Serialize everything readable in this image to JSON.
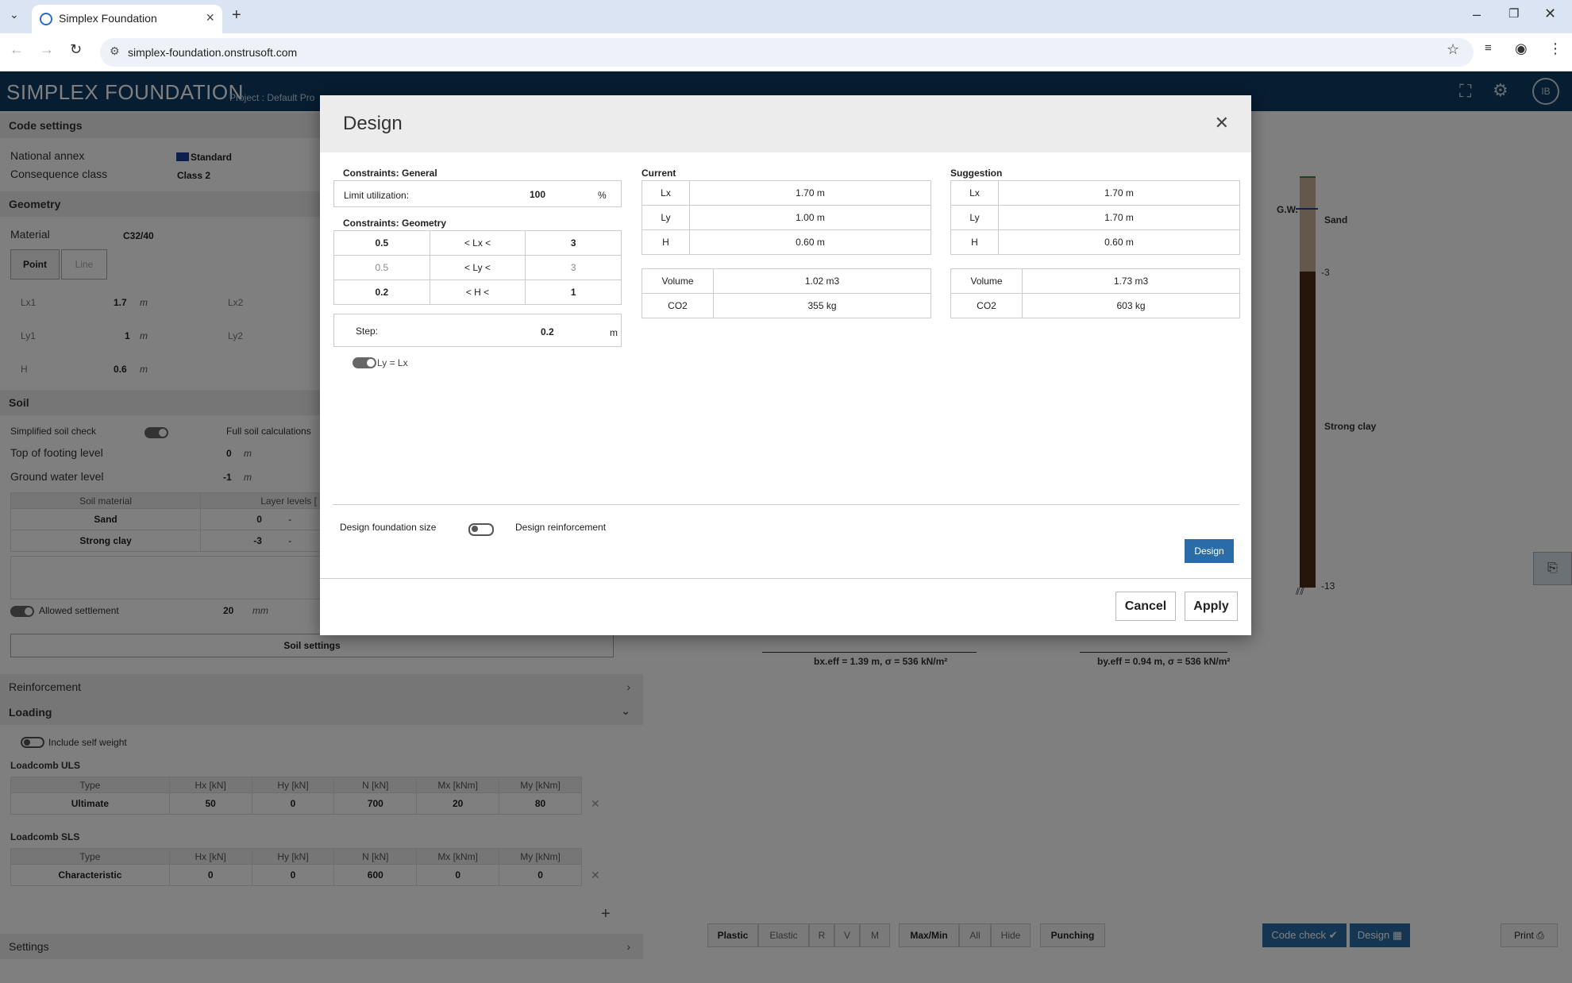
{
  "browser": {
    "tab_title": "Simplex Foundation",
    "url": "simplex-foundation.onstrusoft.com"
  },
  "app": {
    "brand_simplex": "SIMPLEX",
    "brand_foundation": "FOUNDATION",
    "project_label": "Project :",
    "project_name": "Default Pro",
    "avatar": "IB"
  },
  "left": {
    "code_settings": {
      "title": "Code settings",
      "national_annex_label": "National annex",
      "national_annex_value": "Standard",
      "consequence_class_label": "Consequence class",
      "consequence_class_value": "Class 2"
    },
    "geometry": {
      "title": "Geometry",
      "material_label": "Material",
      "material_value": "C32/40",
      "point_tab": "Point",
      "line_tab": "Line",
      "lx1_label": "Lx1",
      "lx1_value": "1.7",
      "lx2_label": "Lx2",
      "ly1_label": "Ly1",
      "ly1_value": "1",
      "ly2_label": "Ly2",
      "h_label": "H",
      "h_value": "0.6",
      "unit": "m"
    },
    "soil": {
      "title": "Soil",
      "simplified_label": "Simplified soil check",
      "full_label": "Full soil calculations",
      "top_footing_label": "Top of footing level",
      "top_footing_value": "0",
      "gwl_label": "Ground water level",
      "gwl_value": "-1",
      "unit": "m",
      "col_material": "Soil material",
      "col_levels": "Layer levels [",
      "rows": [
        {
          "material": "Sand",
          "level": "0",
          "dash": "-"
        },
        {
          "material": "Strong clay",
          "level": "-3",
          "dash": "-"
        }
      ],
      "settlement_label": "Allowed settlement",
      "settlement_value": "20",
      "settlement_unit": "mm",
      "settings_button": "Soil settings"
    },
    "reinforcement_title": "Reinforcement",
    "loading": {
      "title": "Loading",
      "self_weight_label": "Include self weight",
      "uls_title": "Loadcomb ULS",
      "sls_title": "Loadcomb SLS",
      "headers": [
        "Type",
        "Hx [kN]",
        "Hy [kN]",
        "N [kN]",
        "Mx [kNm]",
        "My [kNm]"
      ],
      "uls_row": [
        "Ultimate",
        "50",
        "0",
        "700",
        "20",
        "80"
      ],
      "sls_row": [
        "Characteristic",
        "0",
        "0",
        "600",
        "0",
        "0"
      ],
      "remove": "✕",
      "add": "+"
    },
    "settings_title": "Settings"
  },
  "right": {
    "gw_label": "G.W.",
    "sand_label": "Sand",
    "clay_label": "Strong clay",
    "level_minus3": "-3",
    "level_minus13": "-13",
    "bx_label": "bx.eff = 1.39 m, σ = 536 kN/m²",
    "by_label": "by.eff = 0.94 m, σ = 536 kN/m²",
    "bottom": {
      "plastic": "Plastic",
      "elastic": "Elastic",
      "r": "R",
      "v": "V",
      "m": "M",
      "maxmin": "Max/Min",
      "all": "All",
      "hide": "Hide",
      "punching": "Punching",
      "code_check": "Code check",
      "design": "Design",
      "print": "Print"
    }
  },
  "modal": {
    "title": "Design",
    "close": "✕",
    "constraints_general": "Constraints:  General",
    "limit_label": "Limit utilization:",
    "limit_value": "100",
    "limit_unit": "%",
    "constraints_geometry": "Constraints:  Geometry",
    "geo_rows": [
      {
        "min": "0.5",
        "op": "<  Lx  <",
        "max": "3",
        "muted": false
      },
      {
        "min": "0.5",
        "op": "<  Ly  <",
        "max": "3",
        "muted": true
      },
      {
        "min": "0.2",
        "op": "<  H  <",
        "max": "1",
        "muted": false
      }
    ],
    "step_label": "Step:",
    "step_value": "0.2",
    "step_unit": "m",
    "ly_eq_lx": "Ly = Lx",
    "current_title": "Current",
    "current": {
      "lx_label": "Lx",
      "lx": "1.70 m",
      "ly_label": "Ly",
      "ly": "1.00 m",
      "h_label": "H",
      "h": "0.60 m",
      "volume_label": "Volume",
      "volume": "1.02 m3",
      "co2_label": "CO2",
      "co2": "355 kg"
    },
    "suggestion_title": "Suggestion",
    "suggestion": {
      "lx_label": "Lx",
      "lx": "1.70 m",
      "ly_label": "Ly",
      "ly": "1.70 m",
      "h_label": "H",
      "h": "0.60 m",
      "volume_label": "Volume",
      "volume": "1.73 m3",
      "co2_label": "CO2",
      "co2": "603 kg"
    },
    "design_size_label": "Design foundation size",
    "design_reinf_label": "Design reinforcement",
    "design_button": "Design",
    "cancel": "Cancel",
    "apply": "Apply"
  }
}
